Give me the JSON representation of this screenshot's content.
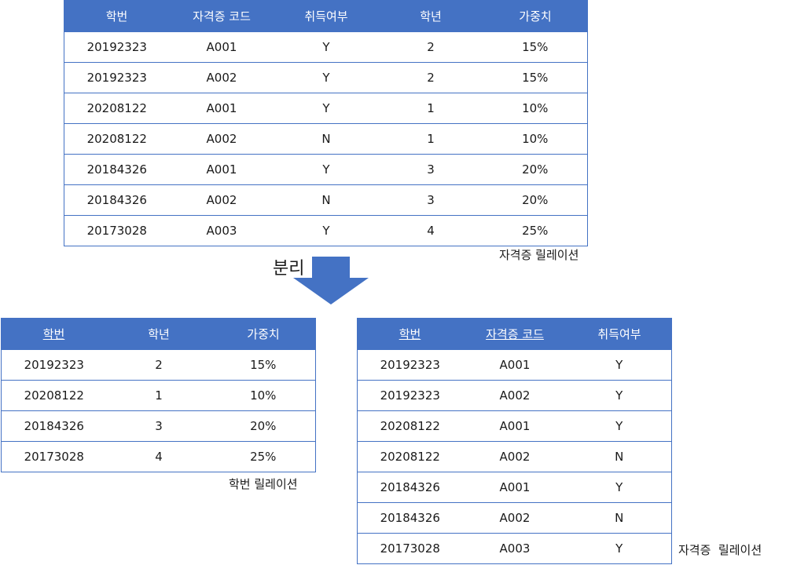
{
  "top_table": {
    "headers": [
      "학번",
      "자격증 코드",
      "취득여부",
      "학년",
      "가중치"
    ],
    "rows": [
      [
        "20192323",
        "A001",
        "Y",
        "2",
        "15%"
      ],
      [
        "20192323",
        "A002",
        "Y",
        "2",
        "15%"
      ],
      [
        "20208122",
        "A001",
        "Y",
        "1",
        "10%"
      ],
      [
        "20208122",
        "A002",
        "N",
        "1",
        "10%"
      ],
      [
        "20184326",
        "A001",
        "Y",
        "3",
        "20%"
      ],
      [
        "20184326",
        "A002",
        "N",
        "3",
        "20%"
      ],
      [
        "20173028",
        "A003",
        "Y",
        "4",
        "25%"
      ]
    ],
    "caption": "자격증 릴레이션"
  },
  "split_label": "분리",
  "left_table": {
    "headers": [
      "학번",
      "학년",
      "가중치"
    ],
    "rows": [
      [
        "20192323",
        "2",
        "15%"
      ],
      [
        "20208122",
        "1",
        "10%"
      ],
      [
        "20184326",
        "3",
        "20%"
      ],
      [
        "20173028",
        "4",
        "25%"
      ]
    ],
    "caption": "학번 릴레이션"
  },
  "right_table": {
    "headers": [
      "학번",
      "자격증 코드",
      "취득여부"
    ],
    "rows": [
      [
        "20192323",
        "A001",
        "Y"
      ],
      [
        "20192323",
        "A002",
        "Y"
      ],
      [
        "20208122",
        "A001",
        "Y"
      ],
      [
        "20208122",
        "A002",
        "N"
      ],
      [
        "20184326",
        "A001",
        "Y"
      ],
      [
        "20184326",
        "A002",
        "N"
      ],
      [
        "20173028",
        "A003",
        "Y"
      ]
    ],
    "caption": "자격증  릴레이션"
  },
  "colors": {
    "header_bg": "#4472c4",
    "border": "#4472c4",
    "arrow": "#4472c4"
  }
}
